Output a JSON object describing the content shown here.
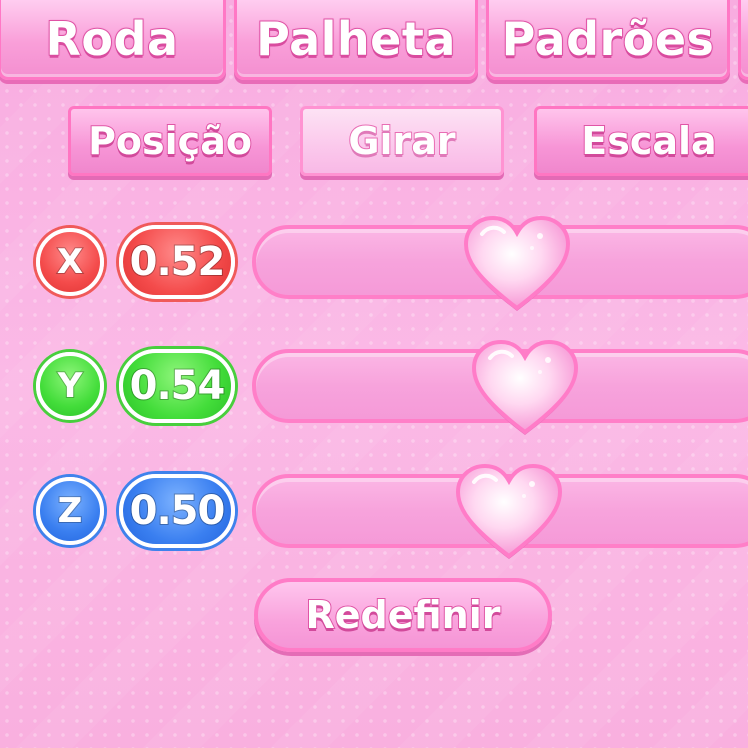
{
  "top_tabs": [
    {
      "label": "Roda"
    },
    {
      "label": "Palheta"
    },
    {
      "label": "Padrões"
    }
  ],
  "sub_tabs": [
    {
      "label": "Posição",
      "active": false
    },
    {
      "label": "Girar",
      "active": true
    },
    {
      "label": "Escala",
      "active": false
    }
  ],
  "axes": [
    {
      "axis": "X",
      "value": "0.52",
      "level": 0.52,
      "color": "#f44b4b"
    },
    {
      "axis": "Y",
      "value": "0.54",
      "level": 0.54,
      "color": "#43dd3a"
    },
    {
      "axis": "Z",
      "value": "0.50",
      "level": 0.5,
      "color": "#3a7ff0"
    }
  ],
  "reset_label": "Redefinir",
  "thumb_icon": "heart-icon"
}
